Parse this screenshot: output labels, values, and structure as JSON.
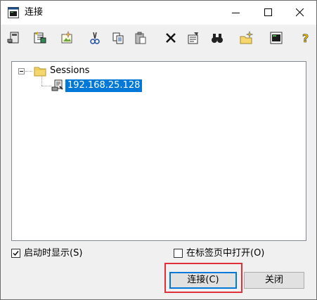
{
  "window": {
    "title": "连接",
    "controls": {
      "minimize": "minimize-icon",
      "maximize": "maximize-icon",
      "close": "close-icon"
    }
  },
  "toolbar": {
    "icons": [
      "quick-connect-icon",
      "connect-in-tab-icon",
      "new-session-icon",
      "cut-icon",
      "copy-icon",
      "paste-icon",
      "delete-icon",
      "properties-icon",
      "find-icon",
      "new-folder-icon",
      "create-shortcut-icon",
      "help-icon"
    ]
  },
  "tree": {
    "root": {
      "label": "Sessions",
      "expanded": true
    },
    "sessions": [
      {
        "label": "192.168.25.128",
        "selected": true
      }
    ]
  },
  "options": {
    "show_on_startup": {
      "label": "启动时显示(S)",
      "checked": true
    },
    "open_in_tab": {
      "label": "在标签页中打开(O)",
      "checked": false
    }
  },
  "buttons": {
    "connect": "连接(C)",
    "close": "关闭"
  },
  "colors": {
    "selection": "#0078d7",
    "highlight_box": "#e0303a"
  }
}
